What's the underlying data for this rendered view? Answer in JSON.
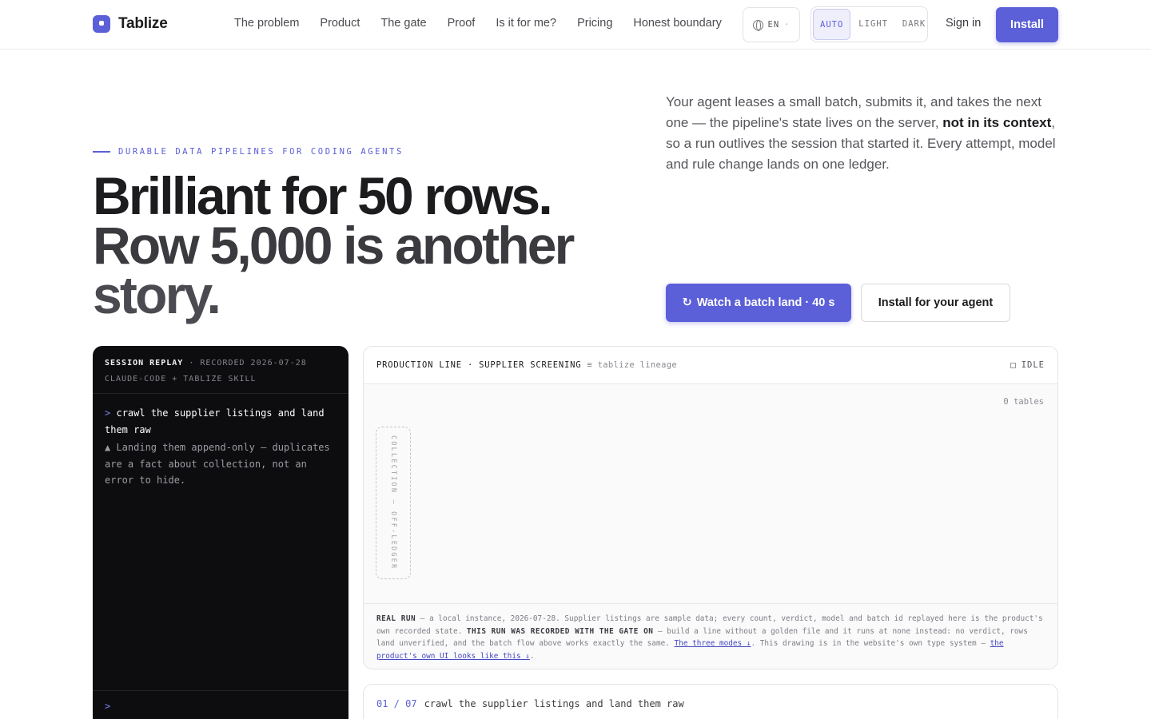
{
  "brand": {
    "name": "Tablize"
  },
  "nav": {
    "links": [
      "The problem",
      "Product",
      "The gate",
      "Proof",
      "Is it for me?",
      "Pricing",
      "Honest boundary"
    ],
    "lang": "EN",
    "lang_caret": "·",
    "theme": [
      "AUTO",
      "LIGHT",
      "DARK"
    ],
    "theme_active": "AUTO",
    "signin": "Sign in",
    "install": "Install"
  },
  "hero": {
    "eyebrow": "DURABLE DATA PIPELINES FOR CODING AGENTS",
    "headline": [
      "Brilliant for 50 rows.",
      "Row 5,000 is another",
      "story."
    ],
    "intro_a": "Your agent leases a small batch, submits it, and takes the next one — the pipeline's state lives on the server, ",
    "intro_b": "not in its context",
    "intro_c": ", so a run outlives the session that started it. Every attempt, model and rule change lands on one ledger.",
    "cta_primary_icon": "↻",
    "cta_primary": "Watch a batch land · 40 s",
    "cta_secondary": "Install for your agent"
  },
  "terminal": {
    "title": "SESSION REPLAY",
    "meta": "· RECORDED 2026-07-28",
    "agent": "CLAUDE-CODE + TABLIZE SKILL",
    "prompt": ">",
    "command": "crawl the supplier listings and land them raw",
    "note": "▲ Landing them append-only — duplicates are a fact about collection, not an error to hide.",
    "input_prompt": ">"
  },
  "panel": {
    "title": "PRODUCTION LINE · SUPPLIER SCREENING",
    "subtitle": "≡ tablize lineage",
    "status": "IDLE",
    "tables": "0 tables",
    "collection": "COLLECTION — OFF-LEDGER",
    "foot": {
      "label1": "REAL RUN",
      "text1": " — a local instance, 2026-07-28. Supplier listings are sample data; every count, verdict, model and batch id replayed here is the product's own recorded state. ",
      "label2": "THIS RUN WAS RECORDED WITH THE GATE ON",
      "text2": " — build a line without a golden file and it runs at none instead: no verdict, rows land unverified, and the batch flow above works exactly the same. ",
      "link1": "The three modes ↓",
      "text3": ". This drawing is in the website's own type system — ",
      "link2": "the product's own UI looks like this ↓",
      "text4": "."
    }
  },
  "step": {
    "num": "01 / 07",
    "text": "crawl the supplier listings and land them raw"
  },
  "colors": {
    "accent": "#5b5fd8",
    "terminal_bg": "#0d0d10"
  }
}
